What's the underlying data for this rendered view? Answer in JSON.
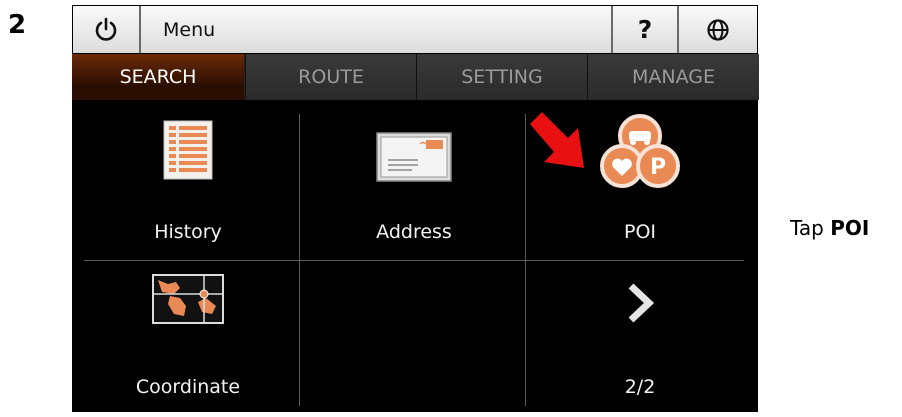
{
  "step": {
    "number": "2"
  },
  "topbar": {
    "power_icon": "power-icon",
    "menu_label": "Menu",
    "help_label": "?",
    "globe_icon": "globe-icon"
  },
  "tabs": [
    {
      "label": "SEARCH",
      "active": true
    },
    {
      "label": "ROUTE",
      "active": false
    },
    {
      "label": "SETTING",
      "active": false
    },
    {
      "label": "MANAGE",
      "active": false
    }
  ],
  "grid": {
    "history_label": "History",
    "address_label": "Address",
    "poi_label": "POI",
    "coordinate_label": "Coordinate",
    "next_icon": "chevron-right-icon",
    "page_indicator": "2/2"
  },
  "instruction": {
    "prefix": "Tap ",
    "target": "POI"
  },
  "colors": {
    "accent": "#e98a55",
    "arrow": "#e81010",
    "active_tab": "#6b2a08"
  }
}
